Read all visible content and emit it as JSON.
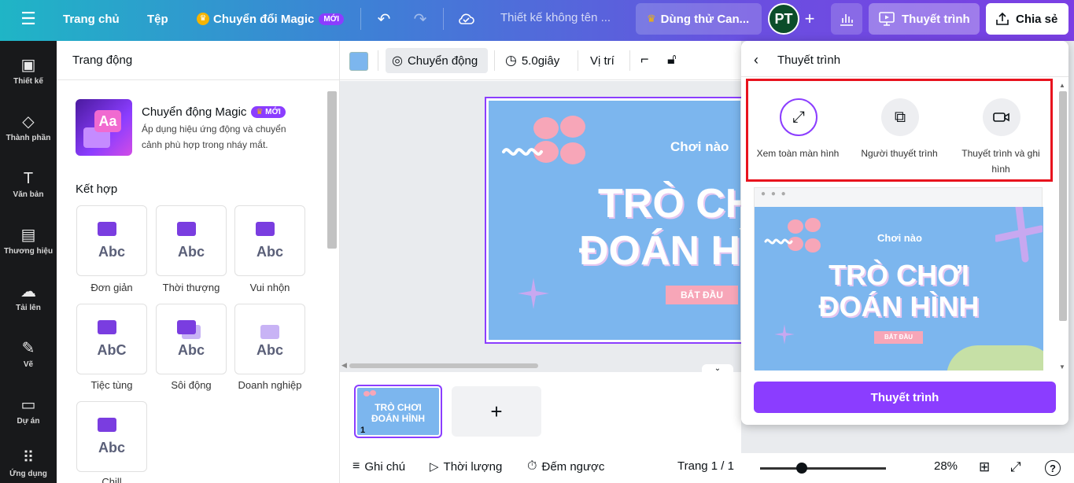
{
  "topbar": {
    "menu_icon": "hamburger-icon",
    "home": "Trang chủ",
    "file": "Tệp",
    "magic": "Chuyển đổi Magic",
    "magic_badge": "MỚI",
    "doc_title": "Thiết kế không tên ...",
    "trial": "Dùng thử Can...",
    "avatar": "PT",
    "present": "Thuyết trình",
    "share": "Chia sẻ"
  },
  "rail": [
    {
      "label": "Thiết kế",
      "icon": "layout-icon"
    },
    {
      "label": "Thành phần",
      "icon": "shapes-icon"
    },
    {
      "label": "Văn bản",
      "icon": "text-icon"
    },
    {
      "label": "Thương hiệu",
      "icon": "brand-icon"
    },
    {
      "label": "Tải lên",
      "icon": "upload-cloud-icon"
    },
    {
      "label": "Vẽ",
      "icon": "draw-icon"
    },
    {
      "label": "Dự án",
      "icon": "folder-icon"
    },
    {
      "label": "Ứng dụng",
      "icon": "apps-grid-icon"
    }
  ],
  "panel": {
    "title": "Trang động",
    "magic_title": "Chuyển động Magic",
    "magic_badge": "MỚI",
    "magic_desc": "Áp dụng hiệu ứng động và chuyển cảnh phù hợp trong nháy mắt.",
    "combo_title": "Kết hợp",
    "thumb_text": "Aa",
    "card_text": "Abc",
    "card_text_alt": "AbC",
    "animations": [
      "Đơn giản",
      "Thời thượng",
      "Vui nhộn",
      "Tiệc tùng",
      "Sôi động",
      "Doanh nghiệp",
      "Chill"
    ]
  },
  "toolbar": {
    "swatch_color": "#7cb6ee",
    "animate": "Chuyển động",
    "duration": "5.0giây",
    "position": "Vị trí"
  },
  "slide": {
    "kicker": "Chơi nào",
    "line1": "TRÒ CHƠI",
    "line2": "ĐOÁN HÌNH",
    "start": "BẮT ĐẦU"
  },
  "pages": {
    "thumb_line1": "TRÒ CHƠI",
    "thumb_line2": "ĐOÁN HÌNH",
    "page_number": "1",
    "add": "+"
  },
  "bottombar": {
    "notes": "Ghi chú",
    "duration": "Thời lượng",
    "timer": "Đếm ngược",
    "page": "Trang 1 / 1",
    "zoom": "28%"
  },
  "popover": {
    "title": "Thuyết trình",
    "options": [
      {
        "label": "Xem toàn màn hình",
        "icon": "fullscreen-icon"
      },
      {
        "label": "Người thuyết trình",
        "icon": "presenter-view-icon"
      },
      {
        "label": "Thuyết trình và ghi hình",
        "icon": "video-camera-icon"
      }
    ],
    "preview_kicker": "Chơi nào",
    "preview_line1": "TRÒ CHƠI",
    "preview_line2": "ĐOÁN HÌNH",
    "preview_start": "BẮT ĐẦU",
    "button": "Thuyết trình"
  },
  "colors": {
    "accent": "#8b3dff",
    "highlight_box": "#e8131e",
    "slide_bg": "#7cb6ee",
    "blob_pink": "#f7a6b8"
  }
}
